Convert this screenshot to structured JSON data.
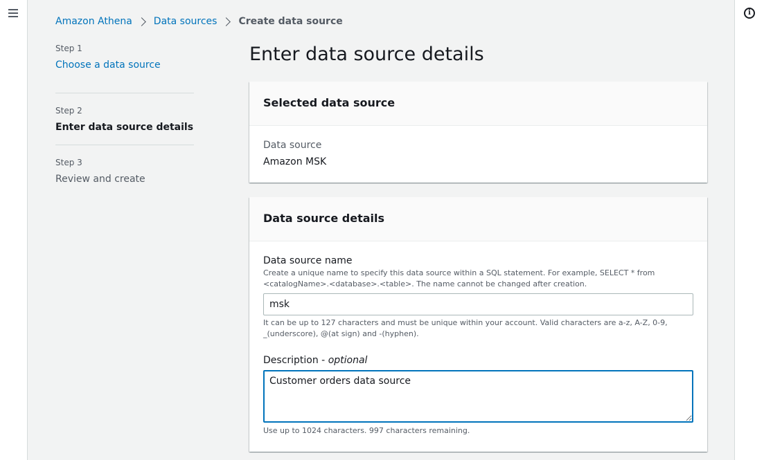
{
  "icons": {
    "menu": "hamburger-menu-icon",
    "info": "info-icon",
    "separator": "chevron-right-icon"
  },
  "colors": {
    "link": "#0073bb",
    "focus": "#0073bb",
    "text": "#16191f",
    "muted": "#545b64"
  },
  "breadcrumb": {
    "items": [
      "Amazon Athena",
      "Data sources"
    ],
    "current": "Create data source"
  },
  "steps": [
    {
      "number": "Step 1",
      "title": "Choose a data source"
    },
    {
      "number": "Step 2",
      "title": "Enter data source details"
    },
    {
      "number": "Step 3",
      "title": "Review and create"
    }
  ],
  "page": {
    "title": "Enter data source details"
  },
  "selected_panel": {
    "header": "Selected data source",
    "label": "Data source",
    "value": "Amazon MSK"
  },
  "details_panel": {
    "header": "Data source details",
    "name_field": {
      "label": "Data source name",
      "description": "Create a unique name to specify this data source within a SQL statement. For example, SELECT * from <catalogName>.<database>.<table>. The name cannot be changed after creation.",
      "value": "msk",
      "constraint": "It can be up to 127 characters and must be unique within your account. Valid characters are a-z, A-Z, 0-9, _(underscore), @(at sign) and -(hyphen)."
    },
    "description_field": {
      "label": "Description - ",
      "optional": "optional",
      "value": "Customer orders data source",
      "constraint": "Use up to 1024 characters. 997 characters remaining."
    }
  }
}
